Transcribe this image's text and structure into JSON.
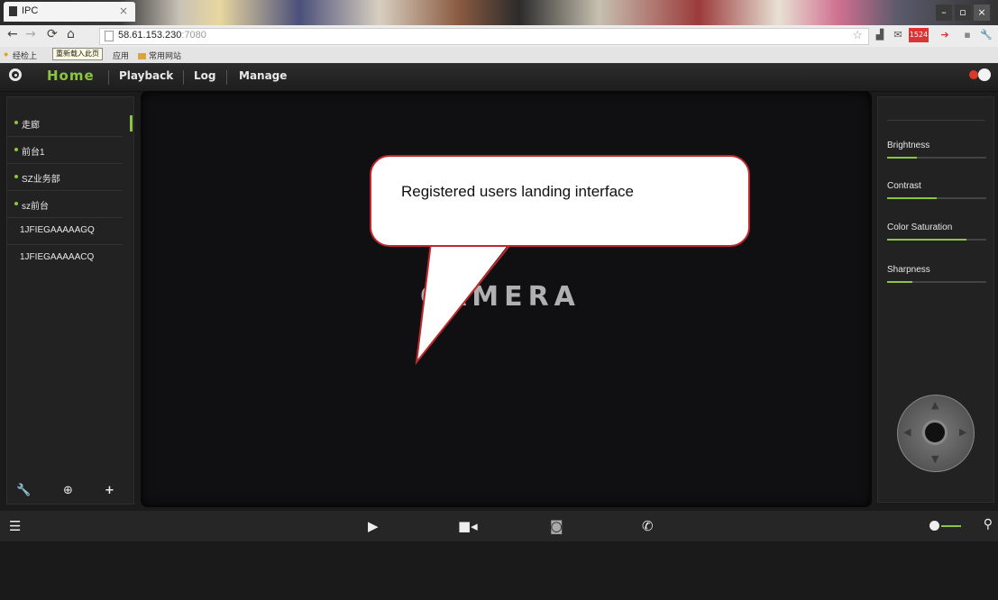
{
  "browser": {
    "tab_title": "IPC",
    "url_host": "58.61.153.230",
    "url_port": ":7080",
    "tooltip": "重新载入此页",
    "bookmarks": [
      "经检上",
      "应用",
      "常用网站"
    ],
    "mail_count": "1524"
  },
  "app": {
    "nav": {
      "home": "Home",
      "playback": "Playback",
      "log": "Log",
      "manage": "Manage"
    },
    "cameras": [
      {
        "label": "走廊",
        "online": true
      },
      {
        "label": "前台1",
        "online": true
      },
      {
        "label": "SZ业务部",
        "online": true
      },
      {
        "label": "sz前台",
        "online": true
      },
      {
        "label": "1JFIEGAAAAAGQ",
        "online": false
      },
      {
        "label": "1JFIEGAAAAACQ",
        "online": false
      }
    ],
    "main_logo": "CAMERA",
    "adjustments": [
      {
        "label": "Brightness",
        "level": 0.3
      },
      {
        "label": "Contrast",
        "level": 0.5
      },
      {
        "label": "Color Saturation",
        "level": 0.8
      },
      {
        "label": "Sharpness",
        "level": 0.25
      }
    ],
    "callout": "Registered users landing interface",
    "icons": {
      "sidebar_tools": [
        "wrench-icon",
        "search-icon",
        "add-icon"
      ],
      "bottom": [
        "menu-icon",
        "play-icon",
        "record-icon",
        "snapshot-icon",
        "phone-icon",
        "volume-icon",
        "user-icon"
      ]
    },
    "accent_color": "#8cc63f",
    "volume_level": 0.6
  }
}
